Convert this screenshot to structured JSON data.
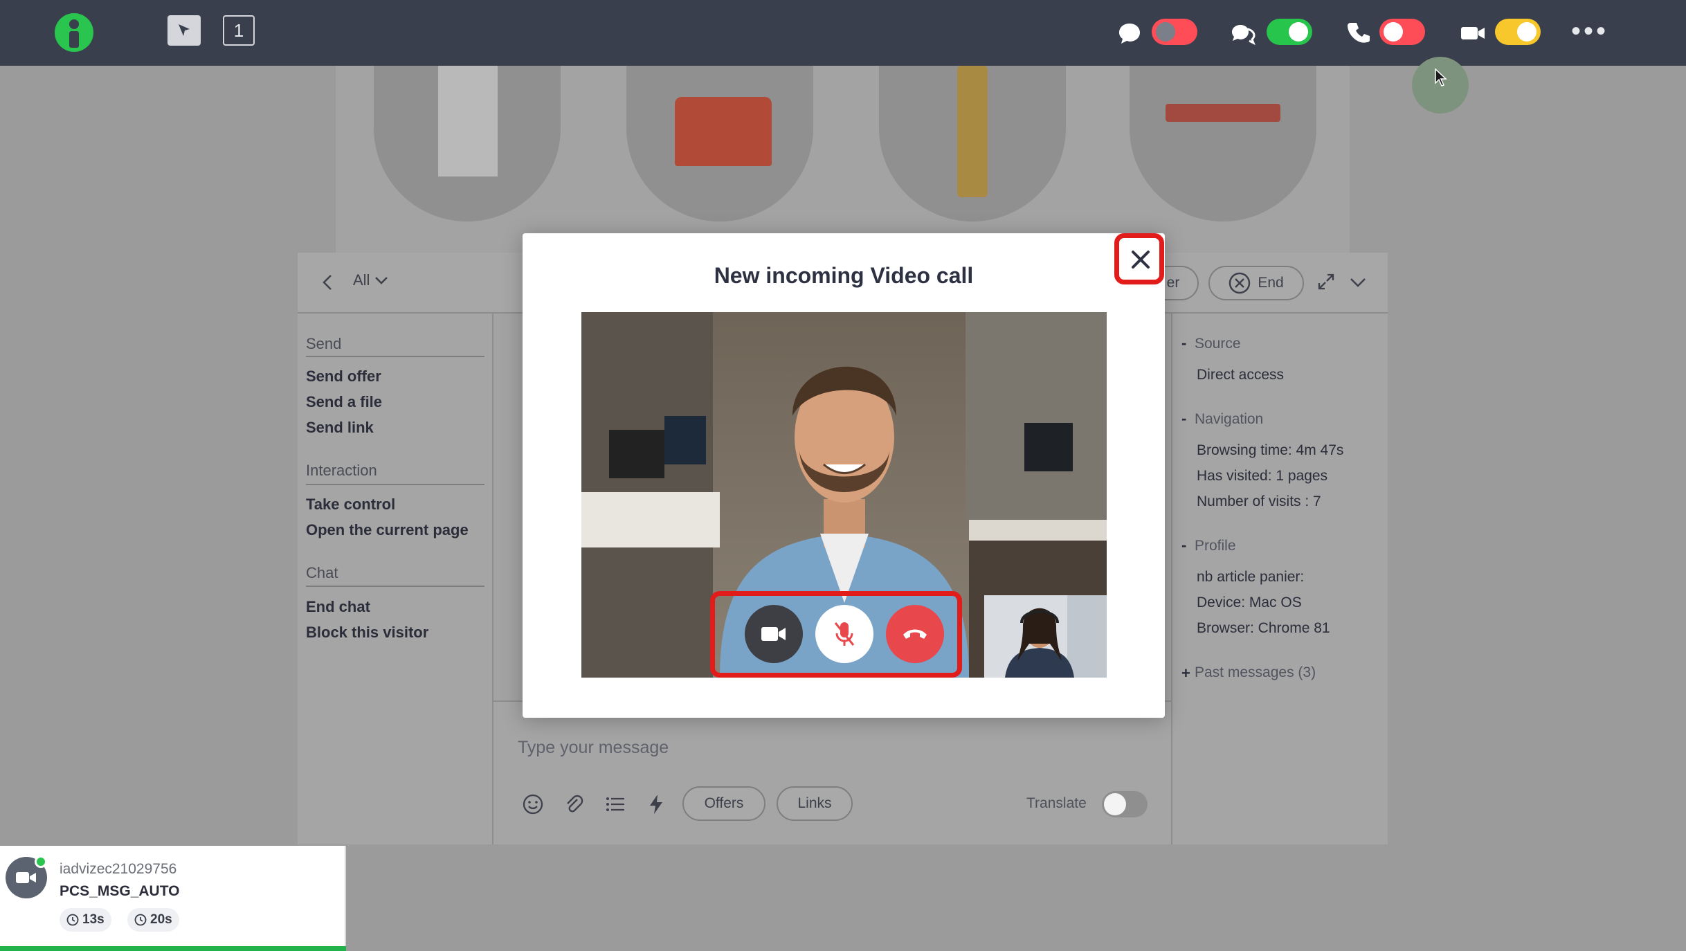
{
  "toolbar": {
    "screen_count": "1",
    "toggles": [
      {
        "name": "chat",
        "state": "off",
        "color": "#ff4d57"
      },
      {
        "name": "messaging",
        "state": "on",
        "color": "#27c54b"
      },
      {
        "name": "phone",
        "state": "off",
        "color": "#ff4d57"
      },
      {
        "name": "video",
        "state": "on",
        "color": "#f8c72c"
      }
    ],
    "more_label": "•••"
  },
  "panel": {
    "filter_label": "All",
    "header_partial_button": "er",
    "end_button": "End",
    "left_menu": {
      "send_header": "Send",
      "send_items": [
        "Send offer",
        "Send a file",
        "Send link"
      ],
      "interaction_header": "Interaction",
      "interaction_items": [
        "Take control",
        "Open the current page"
      ],
      "chat_header": "Chat",
      "chat_items": [
        "End chat",
        "Block this visitor"
      ]
    },
    "info": {
      "source_header": "Source",
      "source_value": "Direct access",
      "navigation_header": "Navigation",
      "browsing_time": "Browsing time: 4m 47s",
      "has_visited": "Has visited: 1 pages",
      "visits": "Number of visits : 7",
      "profile_header": "Profile",
      "article": "nb article panier:",
      "device": "Device: Mac OS",
      "browser": "Browser: Chrome 81",
      "past_messages": "Past messages (3)"
    },
    "composer": {
      "placeholder": "Type your message",
      "offers_button": "Offers",
      "links_button": "Links",
      "translate_label": "Translate"
    }
  },
  "modal": {
    "title": "New incoming Video call"
  },
  "visitor": {
    "id": "iadvizec21029756",
    "name": "PCS_MSG_AUTO",
    "timer1": "13s",
    "timer2": "20s"
  },
  "colors": {
    "topbar": "#3a3f4e",
    "accent_green": "#22b24c",
    "hangup_red": "#e8474b",
    "highlight_red": "#e21b1b"
  }
}
